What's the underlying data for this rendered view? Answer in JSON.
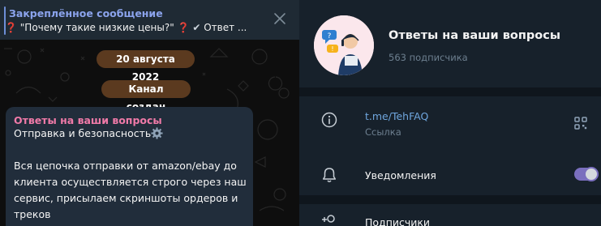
{
  "pinned": {
    "title": "Закреплённое сообщение",
    "text_quote": "\"Почему такие низкие цены?\"",
    "text_rest": "Ответ ...",
    "icons": [
      "question-mark-icon",
      "question-mark-icon",
      "check-mark-icon",
      "close-icon"
    ]
  },
  "chat": {
    "date_pill": "20 августа 2022",
    "service_pill": "Канал создан",
    "message": {
      "sender": "Ответы на ваши вопросы",
      "first_line": "Отправка и безопасность",
      "gear_icon": "gear-icon",
      "body": "Вся цепочка отправки от amazon/ebay до клиента осуществляется строго через наш сервис, присылаем скриншоты ордеров и треков"
    },
    "colors": {
      "pill_bg": "#5b3a1f",
      "bubble_bg": "#212d3b",
      "sender": "#f07aa8",
      "pinned_title": "#8ba3ec"
    }
  },
  "channel": {
    "name": "Ответы на ваши вопросы",
    "subscribers": "563 подписчика",
    "link": "t.me/TehFAQ",
    "link_label": "Ссылка",
    "notifications_label": "Уведомления",
    "notifications_on": true,
    "subscribers_row_label": "Подписчики",
    "colors": {
      "link": "#6fa6de",
      "toggle": "#7a6fbe",
      "background": "#17212b"
    }
  }
}
